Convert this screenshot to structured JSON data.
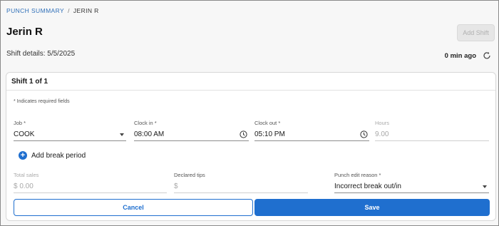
{
  "breadcrumb": {
    "parent": "PUNCH SUMMARY",
    "separator": "/",
    "current": "JERIN R"
  },
  "header": {
    "title": "Jerin R",
    "add_shift_label": "Add Shift",
    "shift_details": "Shift details: 5/5/2025",
    "updated_label": "0 min ago",
    "refresh_icon": "refresh-icon"
  },
  "card": {
    "title": "Shift 1 of 1",
    "required_note": "* Indicates required fields",
    "job": {
      "label": "Job *",
      "value": "COOK"
    },
    "clock_in": {
      "label": "Clock in *",
      "value": "08:00 AM"
    },
    "clock_out": {
      "label": "Clock out *",
      "value": "05:10 PM"
    },
    "hours": {
      "label": "Hours",
      "value": "9.00"
    },
    "add_break_label": "Add break period",
    "total_sales": {
      "label": "Total sales",
      "value": "$ 0.00"
    },
    "declared_tips": {
      "label": "Declared tips",
      "value": "$"
    },
    "punch_edit_reason": {
      "label": "Punch edit reason *",
      "value": "Incorrect break out/in"
    },
    "cancel_label": "Cancel",
    "save_label": "Save"
  },
  "colors": {
    "accent": "#1f6fcf",
    "link": "#2f6fb8",
    "disabled_text": "#a8a8a8"
  }
}
